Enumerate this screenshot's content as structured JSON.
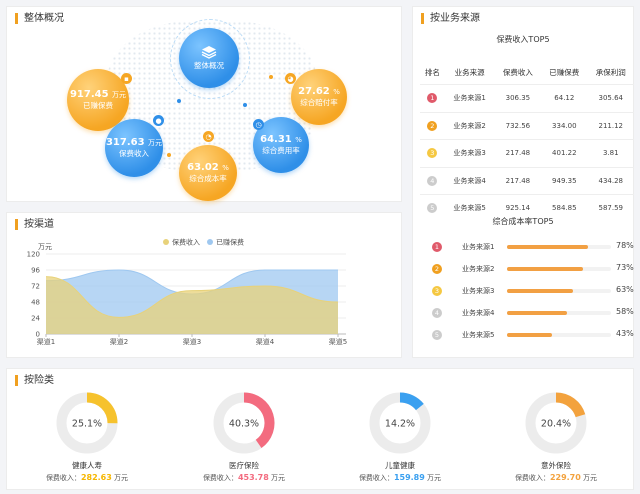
{
  "overview": {
    "title": "整体概况",
    "center_label": "整体概况",
    "earned_premium": {
      "value": "917.45",
      "unit": "万元",
      "label": "已赚保费"
    },
    "premium_income": {
      "value": "317.63",
      "unit": "万元",
      "label": "保费收入"
    },
    "combined_cost_rate": {
      "value": "63.02",
      "unit": "%",
      "label": "综合成本率"
    },
    "combined_loss_ratio": {
      "value": "27.62",
      "unit": "%",
      "label": "综合赔付率"
    },
    "combined_expense_rate": {
      "value": "64.31",
      "unit": "%",
      "label": "综合费用率"
    }
  },
  "business_source": {
    "title": "按业务来源",
    "top5_title": "保费收入TOP5",
    "headers": [
      "排名",
      "业务来源",
      "保费收入",
      "已赚保费",
      "承保利润"
    ],
    "rows": [
      {
        "rank": "1",
        "source": "业务来源1",
        "income": "306.35",
        "earned": "64.12",
        "profit": "305.64"
      },
      {
        "rank": "2",
        "source": "业务来源2",
        "income": "732.56",
        "earned": "334.00",
        "profit": "211.12"
      },
      {
        "rank": "3",
        "source": "业务来源3",
        "income": "217.48",
        "earned": "401.22",
        "profit": "3.81"
      },
      {
        "rank": "4",
        "source": "业务来源4",
        "income": "217.48",
        "earned": "949.35",
        "profit": "434.28"
      },
      {
        "rank": "5",
        "source": "业务来源5",
        "income": "925.14",
        "earned": "584.85",
        "profit": "587.59"
      }
    ],
    "rate_title": "综合成本率TOP5",
    "rates": [
      {
        "rank": "1",
        "source": "业务来源1",
        "value": 78,
        "label": "78%"
      },
      {
        "rank": "2",
        "source": "业务来源2",
        "value": 73,
        "label": "73%"
      },
      {
        "rank": "3",
        "source": "业务来源3",
        "value": 63,
        "label": "63%"
      },
      {
        "rank": "4",
        "source": "业务来源4",
        "value": 58,
        "label": "58%"
      },
      {
        "rank": "5",
        "source": "业务来源5",
        "value": 43,
        "label": "43%"
      }
    ],
    "rank_colors": [
      "#e05a6a",
      "#f0a020",
      "#f5c842",
      "#cccccc",
      "#cccccc"
    ]
  },
  "channel": {
    "title": "按渠道"
  },
  "chart_data": {
    "type": "area",
    "categories": [
      "渠道1",
      "渠道2",
      "渠道3",
      "渠道4",
      "渠道5"
    ],
    "ylabel": "万元",
    "ylim": [
      0,
      120
    ],
    "yticks": [
      0,
      24,
      48,
      72,
      96,
      120
    ],
    "grid": true,
    "legend_position": "top",
    "series": [
      {
        "name": "保费收入",
        "values": [
          86,
          25,
          65,
          72,
          48
        ],
        "color": "#e8d27a"
      },
      {
        "name": "已赚保费",
        "values": [
          80,
          96,
          60,
          96,
          96
        ],
        "color": "#9fc8f0"
      }
    ]
  },
  "insurance_type": {
    "title": "按险类",
    "prefix": "保费收入：",
    "items": [
      {
        "name": "健康人寿",
        "percent": 25.1,
        "percent_label": "25.1%",
        "value": "282.63",
        "unit": "万元",
        "color": "#f6c22d"
      },
      {
        "name": "医疗保险",
        "percent": 40.3,
        "percent_label": "40.3%",
        "value": "453.78",
        "unit": "万元",
        "color": "#f36b7f"
      },
      {
        "name": "儿童健康",
        "percent": 14.2,
        "percent_label": "14.2%",
        "value": "159.89",
        "unit": "万元",
        "color": "#3aa0f0"
      },
      {
        "name": "意外保险",
        "percent": 20.4,
        "percent_label": "20.4%",
        "value": "229.70",
        "unit": "万元",
        "color": "#f3a23d"
      }
    ]
  },
  "icons": {
    "layers": "layers-icon",
    "lock": "lock-icon",
    "pin": "pin-icon"
  }
}
